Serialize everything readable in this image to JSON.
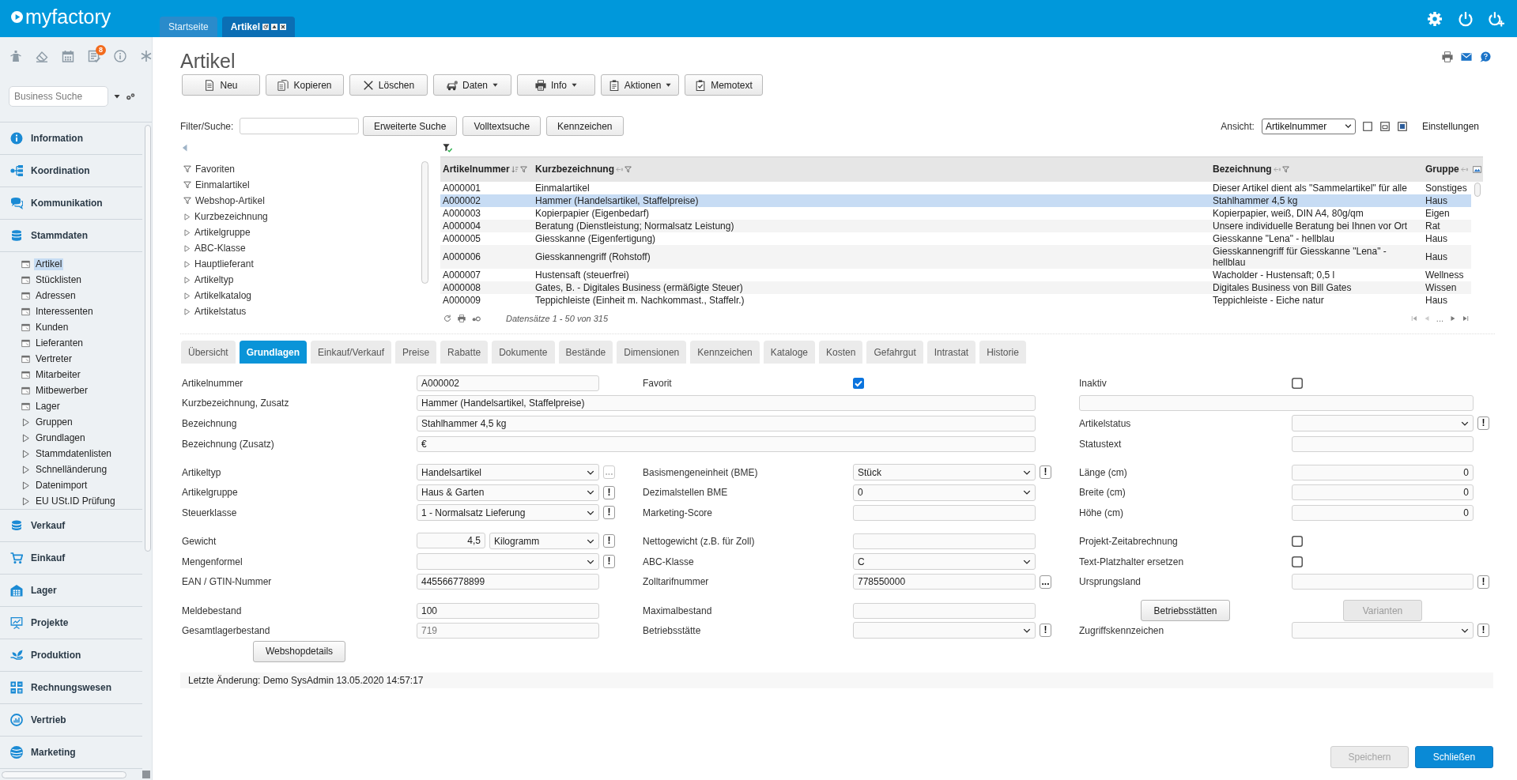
{
  "header": {
    "logo": "myfactory",
    "tabs": [
      {
        "label": "Startseite",
        "selected": false
      },
      {
        "label": "Artikel",
        "selected": true
      }
    ]
  },
  "sidebar": {
    "notification_badge": "8",
    "search": {
      "placeholder": "Business Suche"
    },
    "nav": [
      {
        "label": "Information"
      },
      {
        "label": "Koordination"
      },
      {
        "label": "Kommunikation"
      },
      {
        "label": "Stammdaten",
        "children": [
          {
            "label": "Artikel",
            "kind": "page",
            "selected": true
          },
          {
            "label": "Stücklisten",
            "kind": "page",
            "selected": false
          },
          {
            "label": "Adressen",
            "kind": "page",
            "selected": false
          },
          {
            "label": "Interessenten",
            "kind": "page",
            "selected": false
          },
          {
            "label": "Kunden",
            "kind": "page",
            "selected": false
          },
          {
            "label": "Lieferanten",
            "kind": "page",
            "selected": false
          },
          {
            "label": "Vertreter",
            "kind": "page",
            "selected": false
          },
          {
            "label": "Mitarbeiter",
            "kind": "page",
            "selected": false
          },
          {
            "label": "Mitbewerber",
            "kind": "page",
            "selected": false
          },
          {
            "label": "Lager",
            "kind": "page",
            "selected": false
          },
          {
            "label": "Gruppen",
            "kind": "folder",
            "selected": false
          },
          {
            "label": "Grundlagen",
            "kind": "folder",
            "selected": false
          },
          {
            "label": "Stammdatenlisten",
            "kind": "folder",
            "selected": false
          },
          {
            "label": "Schnelländerung",
            "kind": "folder",
            "selected": false
          },
          {
            "label": "Datenimport",
            "kind": "folder",
            "selected": false
          },
          {
            "label": "EU USt.ID Prüfung",
            "kind": "folder",
            "selected": false
          }
        ]
      },
      {
        "label": "Verkauf"
      },
      {
        "label": "Einkauf"
      },
      {
        "label": "Lager"
      },
      {
        "label": "Projekte"
      },
      {
        "label": "Produktion"
      },
      {
        "label": "Rechnungswesen"
      },
      {
        "label": "Vertrieb"
      },
      {
        "label": "Marketing"
      }
    ]
  },
  "page": {
    "title": "Artikel",
    "toolbar": [
      {
        "label": "Neu",
        "kind": "button"
      },
      {
        "label": "Kopieren",
        "kind": "button"
      },
      {
        "label": "Löschen",
        "kind": "button"
      },
      {
        "label": "Daten",
        "kind": "menu"
      },
      {
        "label": "Info",
        "kind": "menu"
      },
      {
        "label": "Aktionen",
        "kind": "menu"
      },
      {
        "label": "Memotext",
        "kind": "button"
      }
    ]
  },
  "filter": {
    "label": "Filter/Suche:",
    "buttons": [
      "Erweiterte Suche",
      "Volltextsuche",
      "Kennzeichen"
    ],
    "view_label": "Ansicht:",
    "view_value": "Artikelnummer",
    "settings": "Einstellungen"
  },
  "tree": [
    {
      "label": "Favoriten",
      "kind": "filter"
    },
    {
      "label": "Einmalartikel",
      "kind": "filter"
    },
    {
      "label": "Webshop-Artikel",
      "kind": "filter"
    },
    {
      "label": "Kurzbezeichnung",
      "kind": "group"
    },
    {
      "label": "Artikelgruppe",
      "kind": "group"
    },
    {
      "label": "ABC-Klasse",
      "kind": "group"
    },
    {
      "label": "Hauptlieferant",
      "kind": "group"
    },
    {
      "label": "Artikeltyp",
      "kind": "group"
    },
    {
      "label": "Artikelkatalog",
      "kind": "group"
    },
    {
      "label": "Artikelstatus",
      "kind": "group"
    }
  ],
  "table": {
    "columns": [
      {
        "label": "Artikelnummer",
        "sorted": true
      },
      {
        "label": "Kurzbezeichnung",
        "sorted": false
      },
      {
        "label": "Bezeichnung",
        "sorted": false
      },
      {
        "label": "Gruppe",
        "sorted": false
      }
    ],
    "rows": [
      {
        "cells": [
          "A000001",
          "Einmalartikel",
          "Dieser Artikel dient als \"Sammelartikel\" für alle",
          "Sonstiges"
        ],
        "selected": false
      },
      {
        "cells": [
          "A000002",
          "Hammer (Handelsartikel, Staffelpreise)",
          "Stahlhammer 4,5 kg",
          "Haus"
        ],
        "selected": true
      },
      {
        "cells": [
          "A000003",
          "Kopierpapier (Eigenbedarf)",
          "Kopierpapier, weiß, DIN A4, 80g/qm",
          "Eigen"
        ],
        "selected": false
      },
      {
        "cells": [
          "A000004",
          "Beratung (Dienstleistung; Normalsatz Leistung)",
          "Unsere individuelle Beratung bei Ihnen vor Ort",
          "Rat"
        ],
        "selected": false
      },
      {
        "cells": [
          "A000005",
          "Giesskanne (Eigenfertigung)",
          "Giesskanne \"Lena\" - hellblau",
          "Haus"
        ],
        "selected": false
      },
      {
        "cells": [
          "A000006",
          "Giesskannengriff (Rohstoff)",
          "Giesskannengriff für Giesskanne \"Lena\" - hellblau",
          "Haus"
        ],
        "selected": false
      },
      {
        "cells": [
          "A000007",
          "Hustensaft (steuerfrei)",
          "Wacholder - Hustensaft; 0,5 l",
          "Wellness"
        ],
        "selected": false
      },
      {
        "cells": [
          "A000008",
          "Gates, B. - Digitales Business (ermäßigte Steuer)",
          "Digitales Business von Bill Gates",
          "Wissen"
        ],
        "selected": false
      },
      {
        "cells": [
          "A000009",
          "Teppichleiste (Einheit m. Nachkommast., Staffelr.)",
          "Teppichleiste - Eiche natur",
          "Haus"
        ],
        "selected": false
      }
    ],
    "footer": "Datensätze 1 - 50 von 315",
    "pager_more": "..."
  },
  "detail_tabs": [
    {
      "label": "Übersicht",
      "selected": false
    },
    {
      "label": "Grundlagen",
      "selected": true
    },
    {
      "label": "Einkauf/Verkauf",
      "selected": false
    },
    {
      "label": "Preise",
      "selected": false
    },
    {
      "label": "Rabatte",
      "selected": false
    },
    {
      "label": "Dokumente",
      "selected": false
    },
    {
      "label": "Bestände",
      "selected": false
    },
    {
      "label": "Dimensionen",
      "selected": false
    },
    {
      "label": "Kennzeichen",
      "selected": false
    },
    {
      "label": "Kataloge",
      "selected": false
    },
    {
      "label": "Kosten",
      "selected": false
    },
    {
      "label": "Gefahrgut",
      "selected": false
    },
    {
      "label": "Intrastat",
      "selected": false
    },
    {
      "label": "Historie",
      "selected": false
    }
  ],
  "form": {
    "groups": [
      {
        "rows": [
          [
            {
              "kind": "field",
              "label": "Artikelnummer",
              "control": {
                "kind": "text",
                "value": "A000002"
              }
            },
            {
              "kind": "field",
              "label": "Favorit",
              "control": {
                "kind": "checkbox",
                "checked": true
              }
            },
            {
              "kind": "field",
              "label": "Inaktiv",
              "control": {
                "kind": "checkbox",
                "checked": false
              }
            }
          ],
          [
            {
              "kind": "wide",
              "label": "Kurzbezeichnung, Zusatz",
              "control": {
                "kind": "text",
                "value": "Hammer (Handelsartikel, Staffelpreise)"
              }
            },
            {
              "kind": "bare",
              "control": {
                "kind": "text"
              }
            }
          ],
          [
            {
              "kind": "wide",
              "label": "Bezeichnung",
              "control": {
                "kind": "text",
                "value": "Stahlhammer 4,5 kg"
              }
            },
            {
              "kind": "field",
              "label": "Artikelstatus",
              "control": {
                "kind": "select"
              },
              "action": {
                "symbol": "!",
                "disabled": false
              }
            }
          ],
          [
            {
              "kind": "wide",
              "label": "Bezeichnung (Zusatz)",
              "control": {
                "kind": "text",
                "value": "€"
              }
            },
            {
              "kind": "field",
              "label": "Statustext",
              "control": {
                "kind": "text"
              }
            }
          ]
        ]
      },
      {
        "rows": [
          [
            {
              "kind": "field",
              "label": "Artikeltyp",
              "control": {
                "kind": "select",
                "value": "Handelsartikel"
              },
              "action": {
                "symbol": "...",
                "disabled": true
              }
            },
            {
              "kind": "field",
              "label": "Basismengeneinheit (BME)",
              "control": {
                "kind": "select",
                "value": "Stück"
              },
              "action": {
                "symbol": "!",
                "disabled": false
              }
            },
            {
              "kind": "field",
              "label": "Länge (cm)",
              "control": {
                "kind": "number",
                "value": "0"
              }
            }
          ],
          [
            {
              "kind": "field",
              "label": "Artikelgruppe",
              "control": {
                "kind": "select",
                "value": "Haus & Garten"
              },
              "action": {
                "symbol": "!",
                "disabled": false
              }
            },
            {
              "kind": "field",
              "label": "Dezimalstellen BME",
              "control": {
                "kind": "select",
                "value": "0"
              }
            },
            {
              "kind": "field",
              "label": "Breite (cm)",
              "control": {
                "kind": "number",
                "value": "0"
              }
            }
          ],
          [
            {
              "kind": "field",
              "label": "Steuerklasse",
              "control": {
                "kind": "select",
                "value": "1 - Normalsatz Lieferung"
              },
              "action": {
                "symbol": "!",
                "disabled": false
              }
            },
            {
              "kind": "field",
              "label": "Marketing-Score",
              "control": {
                "kind": "text"
              }
            },
            {
              "kind": "field",
              "label": "Höhe (cm)",
              "control": {
                "kind": "number",
                "value": "0"
              }
            }
          ]
        ]
      },
      {
        "rows": [
          [
            {
              "kind": "field",
              "label": "Gewicht",
              "control": {
                "kind": "measure",
                "value": "4,5",
                "unit": "Kilogramm"
              },
              "action": {
                "symbol": "!",
                "disabled": false
              }
            },
            {
              "kind": "field",
              "label": "Nettogewicht (z.B. für Zoll)",
              "control": {
                "kind": "text"
              }
            },
            {
              "kind": "field",
              "label": "Projekt-Zeitabrechnung",
              "control": {
                "kind": "checkbox",
                "checked": false
              }
            }
          ],
          [
            {
              "kind": "field",
              "label": "Mengenformel",
              "control": {
                "kind": "select"
              },
              "action": {
                "symbol": "!",
                "disabled": false
              }
            },
            {
              "kind": "field",
              "label": "ABC-Klasse",
              "control": {
                "kind": "select",
                "value": "C"
              }
            },
            {
              "kind": "field",
              "label": "Text-Platzhalter ersetzen",
              "control": {
                "kind": "checkbox",
                "checked": false
              }
            }
          ],
          [
            {
              "kind": "field",
              "label": "EAN / GTIN-Nummer",
              "control": {
                "kind": "text",
                "value": "445566778899"
              }
            },
            {
              "kind": "field",
              "label": "Zolltarifnummer",
              "control": {
                "kind": "text",
                "value": "778550000"
              },
              "action": {
                "symbol": "...",
                "disabled": false
              }
            },
            {
              "kind": "field",
              "label": "Ursprungsland",
              "control": {
                "kind": "text"
              },
              "action": {
                "symbol": "!",
                "disabled": false
              }
            }
          ]
        ]
      },
      {
        "rows": [
          [
            {
              "kind": "field",
              "label": "Meldebestand",
              "control": {
                "kind": "text",
                "value": "100"
              }
            },
            {
              "kind": "field",
              "label": "Maximalbestand",
              "control": {
                "kind": "text"
              }
            },
            {
              "kind": "buttons",
              "buttons": [
                {
                  "label": "Betriebsstätten",
                  "disabled": false
                },
                {
                  "label": "Varianten",
                  "disabled": true
                }
              ]
            }
          ],
          [
            {
              "kind": "field",
              "label": "Gesamtlagerbestand",
              "control": {
                "kind": "readonly",
                "value": "719"
              }
            },
            {
              "kind": "field",
              "label": "Betriebsstätte",
              "control": {
                "kind": "select"
              },
              "action": {
                "symbol": "!",
                "disabled": false
              }
            },
            {
              "kind": "field",
              "label": "Zugriffskennzeichen",
              "control": {
                "kind": "select"
              },
              "action": {
                "symbol": "!",
                "disabled": false
              }
            }
          ],
          [
            {
              "kind": "buttons",
              "buttons": [
                {
                  "label": "Webshopdetails",
                  "disabled": false
                }
              ]
            }
          ]
        ]
      }
    ]
  },
  "status_bar": "Letzte Änderung: Demo SysAdmin 13.05.2020 14:57:17",
  "actions": [
    {
      "label": "Speichern",
      "kind": "default",
      "disabled": true
    },
    {
      "label": "Schließen",
      "kind": "primary",
      "disabled": false
    }
  ]
}
